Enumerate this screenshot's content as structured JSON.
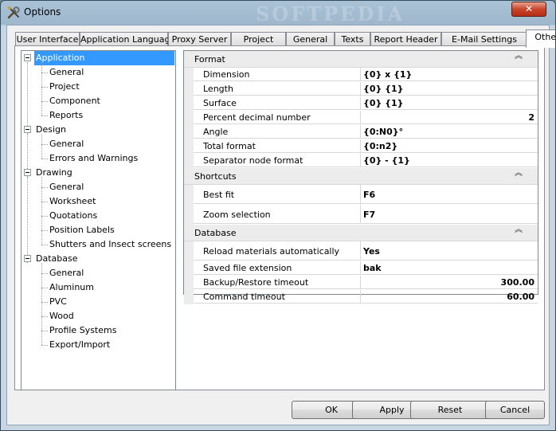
{
  "window": {
    "title": "Options",
    "watermark": "SOFTPEDIA",
    "close_glyph": "✕"
  },
  "tabs": [
    {
      "label": "User Interface"
    },
    {
      "label": "Application Language"
    },
    {
      "label": "Proxy Server"
    },
    {
      "label": "Project"
    },
    {
      "label": "General"
    },
    {
      "label": "Texts"
    },
    {
      "label": "Report Header"
    },
    {
      "label": "E-Mail Settings"
    },
    {
      "label": "Other",
      "active": true
    }
  ],
  "tree": {
    "groups": [
      {
        "label": "Application",
        "selected": true,
        "children": [
          "General",
          "Project",
          "Component",
          "Reports"
        ]
      },
      {
        "label": "Design",
        "children": [
          "General",
          "Errors and Warnings"
        ]
      },
      {
        "label": "Drawing",
        "children": [
          "General",
          "Worksheet",
          "Quotations",
          "Position Labels",
          "Shutters and Insect screens"
        ]
      },
      {
        "label": "Database",
        "children": [
          "General",
          "Aluminum",
          "PVC",
          "Wood",
          "Profile Systems",
          "Export/Import"
        ]
      }
    ]
  },
  "grid": {
    "collapse_glyph": "︽",
    "sections": [
      {
        "name": "Format",
        "rows": [
          {
            "name": "Dimension",
            "value": "{0} x {1}"
          },
          {
            "name": "Length",
            "value": "{0} {1}"
          },
          {
            "name": "Surface",
            "value": "{0} {1}"
          },
          {
            "name": "Percent decimal number",
            "value": "2",
            "numeric": true
          },
          {
            "name": "Angle",
            "value": "{0:N0}°"
          },
          {
            "name": "Total format",
            "value": "{0:n2}"
          },
          {
            "name": "Separator node format",
            "value": "{0} - {1}"
          }
        ]
      },
      {
        "name": "Shortcuts",
        "rows": [
          {
            "name": "Best fit",
            "value": "F6"
          },
          {
            "name": "Zoom selection",
            "value": "F7"
          }
        ]
      },
      {
        "name": "Database",
        "rows": [
          {
            "name": "Reload materials automatically",
            "value": "Yes"
          },
          {
            "name": "Saved file extension",
            "value": "bak"
          },
          {
            "name": "Backup/Restore timeout",
            "value": "300.00",
            "numeric": true
          },
          {
            "name": "Command timeout",
            "value": "60.00",
            "numeric": true
          }
        ]
      }
    ]
  },
  "buttons": {
    "ok": "OK",
    "apply": "Apply",
    "reset": "Reset",
    "cancel": "Cancel"
  }
}
